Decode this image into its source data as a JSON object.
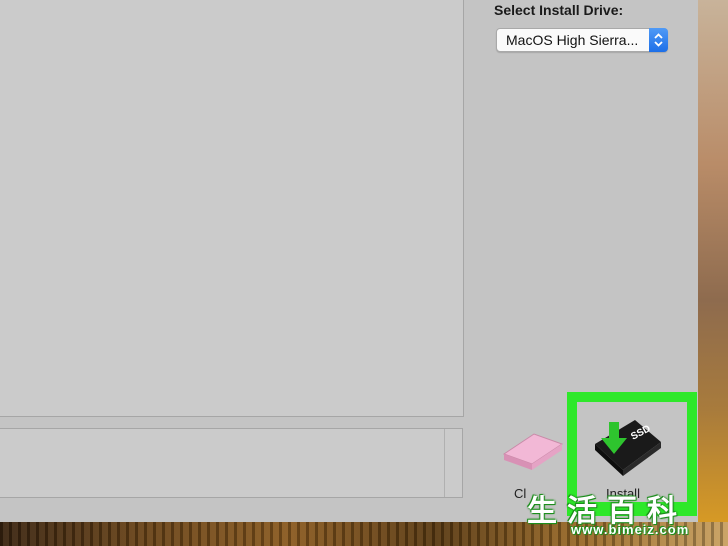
{
  "install_panel": {
    "drive_label": "Select Install Drive:",
    "drive_select_value": "MacOS High Sierra..."
  },
  "toolbar": {
    "clear_label": "Cl",
    "install_label": "Install"
  },
  "icons": {
    "eraser": "eraser-icon",
    "install": "ssd-install-icon",
    "ssd_text": "SSD"
  },
  "watermark": {
    "chars": "生活百科",
    "url": "www.bimeiz.com"
  },
  "colors": {
    "highlight": "#2ee82a",
    "select_accent": "#1d6fe8"
  }
}
